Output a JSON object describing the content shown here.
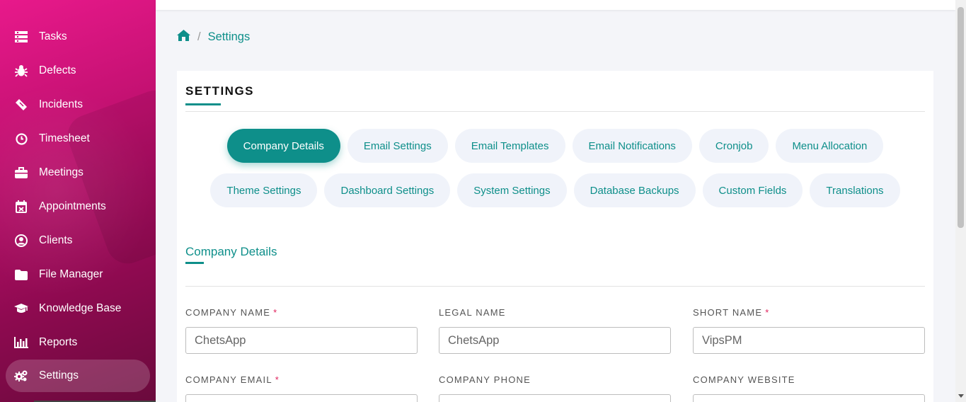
{
  "sidebar": {
    "items": [
      {
        "label": "Tasks",
        "icon": "tasks-icon"
      },
      {
        "label": "Defects",
        "icon": "bug-icon"
      },
      {
        "label": "Incidents",
        "icon": "ticket-icon"
      },
      {
        "label": "Timesheet",
        "icon": "clock-icon"
      },
      {
        "label": "Meetings",
        "icon": "briefcase-icon"
      },
      {
        "label": "Appointments",
        "icon": "calendar-icon"
      },
      {
        "label": "Clients",
        "icon": "user-circle-icon"
      },
      {
        "label": "File Manager",
        "icon": "folder-icon"
      },
      {
        "label": "Knowledge Base",
        "icon": "graduation-cap-icon"
      },
      {
        "label": "Reports",
        "icon": "bar-chart-icon"
      },
      {
        "label": "Settings",
        "icon": "gears-icon",
        "active": true
      }
    ]
  },
  "breadcrumb": {
    "home_icon": "home-icon",
    "separator": "/",
    "current": "Settings"
  },
  "card": {
    "title": "SETTINGS"
  },
  "tabs": {
    "row1": [
      "Company Details",
      "Email Settings",
      "Email Templates",
      "Email Notifications",
      "Cronjob",
      "Menu Allocation"
    ],
    "row2": [
      "Theme Settings",
      "Dashboard Settings",
      "System Settings",
      "Database Backups",
      "Custom Fields",
      "Translations"
    ],
    "active": "Company Details"
  },
  "section": {
    "title": "Company Details"
  },
  "form": {
    "company_name": {
      "label": "COMPANY NAME",
      "required": "*",
      "value": "ChetsApp"
    },
    "legal_name": {
      "label": "LEGAL NAME",
      "value": "ChetsApp"
    },
    "short_name": {
      "label": "SHORT NAME",
      "required": "*",
      "value": "VipsPM"
    },
    "company_email": {
      "label": "COMPANY EMAIL",
      "required": "*"
    },
    "company_phone": {
      "label": "COMPANY PHONE"
    },
    "company_website": {
      "label": "COMPANY WEBSITE"
    }
  },
  "colors": {
    "accent": "#0e8f8a",
    "sidebar": "#c0106f",
    "required": "#e0245e"
  }
}
